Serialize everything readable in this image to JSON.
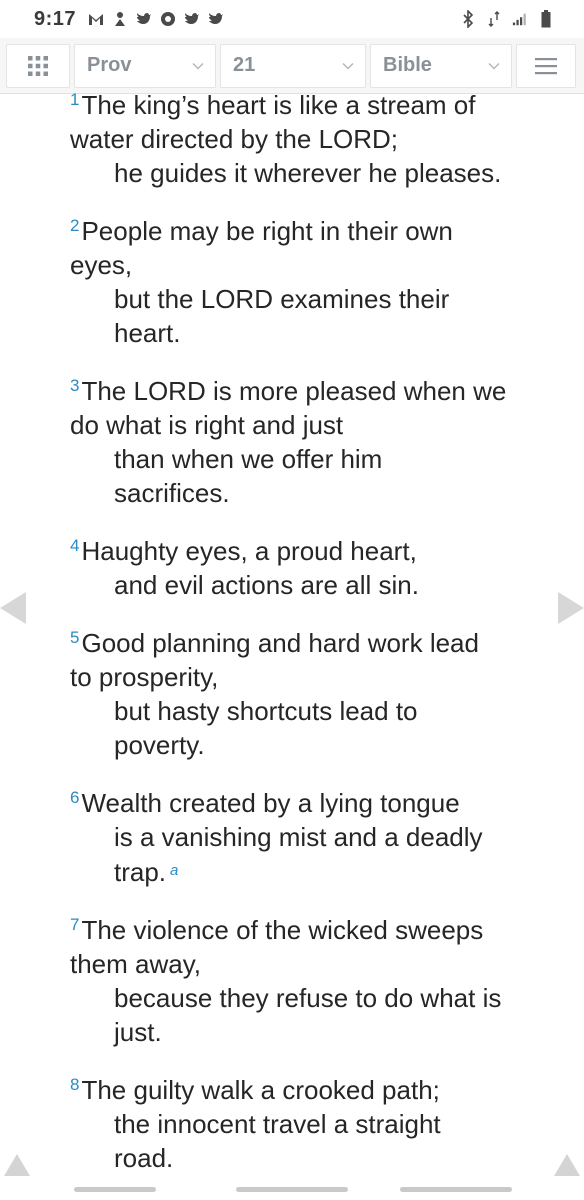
{
  "status_bar": {
    "time": "9:17",
    "left_icons": [
      "gmail-icon",
      "drive-icon",
      "twitter-icon",
      "chrome-icon",
      "twitter-icon",
      "twitter-icon"
    ],
    "right_icons": [
      "bluetooth-icon",
      "data-icon",
      "signal-icon",
      "battery-icon"
    ]
  },
  "toolbar": {
    "book": "Prov",
    "chapter": "21",
    "version": "Bible"
  },
  "verses": [
    {
      "num": "1",
      "lines": [
        "The king’s heart is like a stream of",
        "water directed by the LORD;"
      ],
      "indented": [
        "he guides it wherever he pleases."
      ]
    },
    {
      "num": "2",
      "lines": [
        "People may be right in their own",
        "eyes,"
      ],
      "indented": [
        "but the LORD examines their",
        "heart."
      ]
    },
    {
      "num": "3",
      "lines": [
        "The LORD is more pleased when we",
        "do what is right and just"
      ],
      "indented": [
        "than when we offer him",
        "sacrifices."
      ]
    },
    {
      "num": "4",
      "lines": [
        "Haughty eyes, a proud heart,"
      ],
      "indented": [
        "and evil actions are all sin."
      ]
    },
    {
      "num": "5",
      "lines": [
        "Good planning and hard work lead",
        "to prosperity,"
      ],
      "indented": [
        "but hasty shortcuts lead to",
        "poverty."
      ]
    },
    {
      "num": "6",
      "lines": [
        "Wealth created by a lying tongue"
      ],
      "indented": [
        "is a vanishing mist and a deadly",
        "trap."
      ],
      "footnote": "a"
    },
    {
      "num": "7",
      "lines": [
        "The violence of the wicked sweeps",
        "them away,"
      ],
      "indented": [
        "because they refuse to do what is",
        "just."
      ]
    },
    {
      "num": "8",
      "lines": [
        "The guilty walk a crooked path;"
      ],
      "indented": [
        "the innocent travel a straight",
        "road."
      ]
    }
  ]
}
